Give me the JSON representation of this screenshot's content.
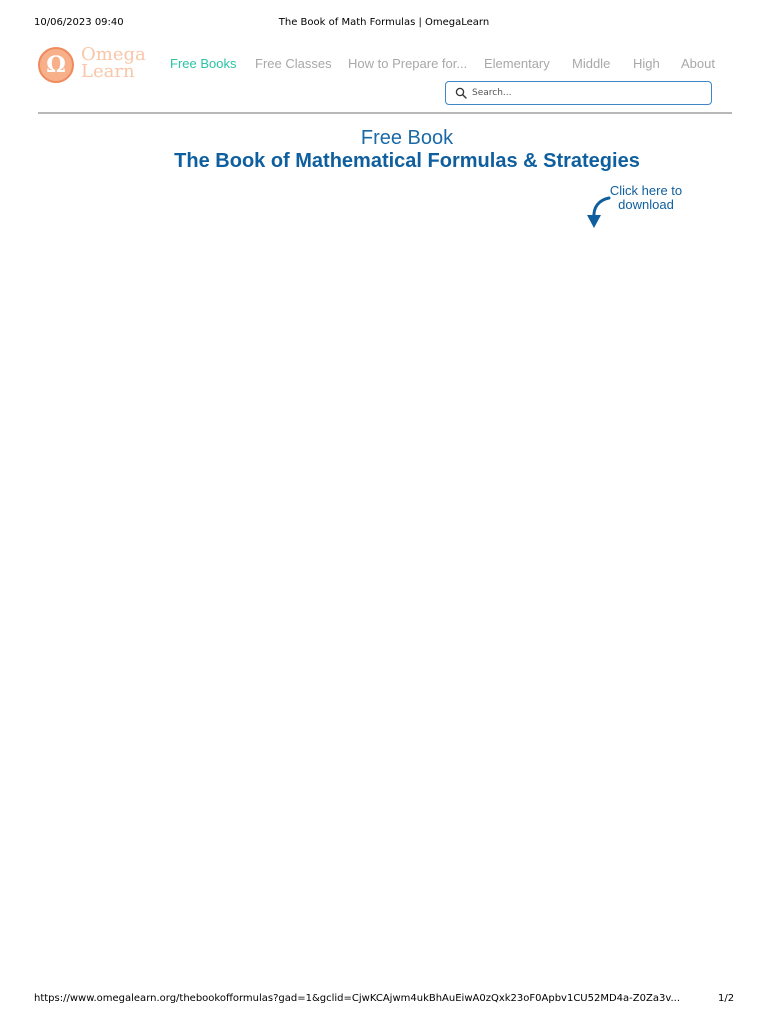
{
  "print_header": {
    "date": "10/06/2023 09:40",
    "title": "The Book of Math Formulas | OmegaLearn"
  },
  "logo": {
    "symbol": "Ω",
    "line1": "Omega",
    "line2": "Learn"
  },
  "nav": {
    "items": [
      {
        "label": "Free Books",
        "active": true
      },
      {
        "label": "Free Classes"
      },
      {
        "label": "How to Prepare for..."
      },
      {
        "label": "Elementary"
      },
      {
        "label": "Middle"
      },
      {
        "label": "High"
      },
      {
        "label": "About"
      }
    ]
  },
  "search": {
    "placeholder": "Search..."
  },
  "main": {
    "subheading": "Free Book",
    "heading": "The Book of Mathematical Formulas & Strategies",
    "download_line1": "Click here to",
    "download_line2": "download"
  },
  "print_footer": {
    "url": "https://www.omegalearn.org/thebookofformulas?gad=1&gclid=CjwKCAjwm4ukBhAuEiwA0zQxk23oF0Apbv1CU52MD4a-Z0Za3v...",
    "page": "1/2"
  },
  "colors": {
    "accent_active": "#2bc3a4",
    "brand_blue": "#0f5f9e",
    "logo_orange": "#ee8a5c",
    "nav_gray": "#a8a8a8"
  },
  "icons": {
    "search": "search-icon",
    "logo": "omega-logo-icon",
    "download_arrow": "curved-arrow-down-icon"
  }
}
